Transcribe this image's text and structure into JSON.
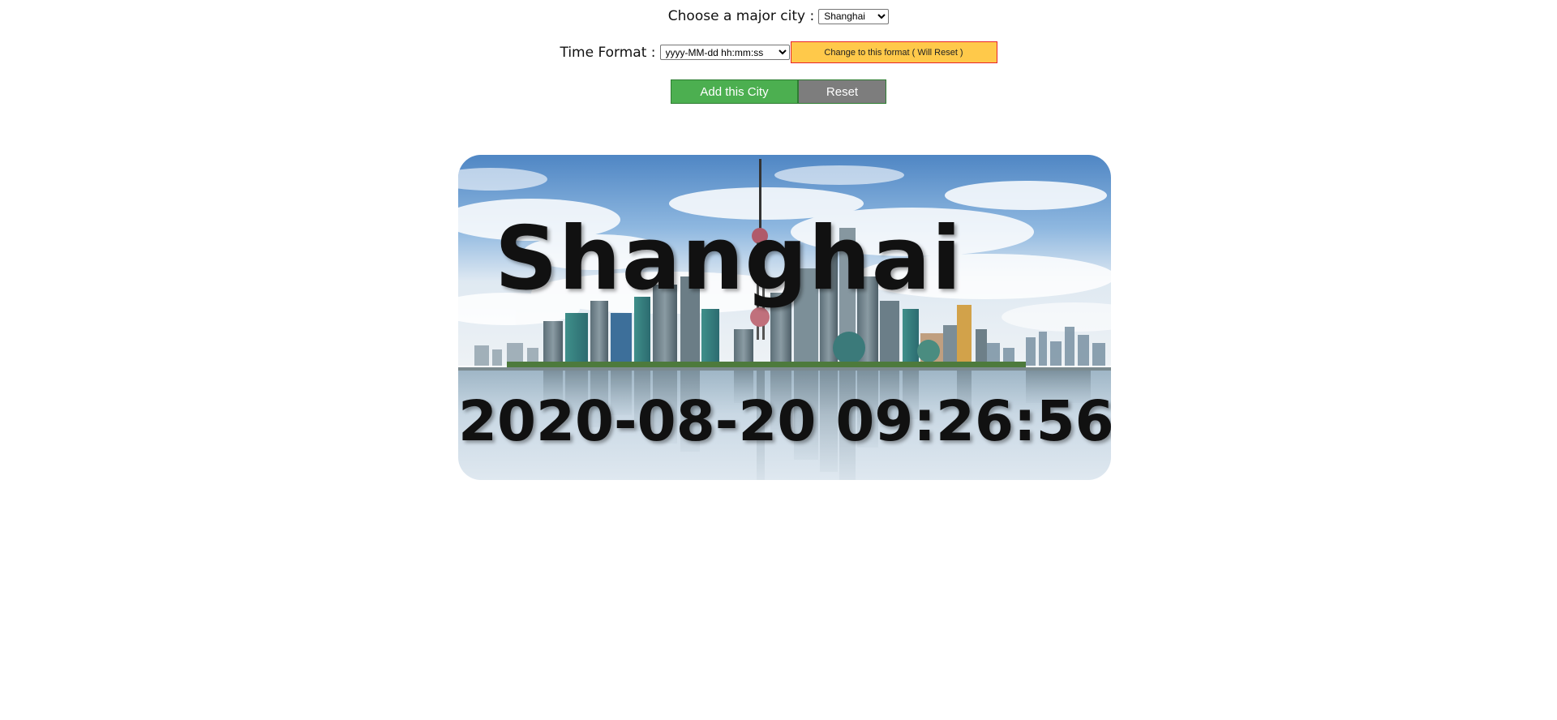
{
  "city_picker": {
    "label": "Choose a major city :",
    "selected": "Shanghai"
  },
  "time_format": {
    "label": "Time Format :",
    "selected": "yyyy-MM-dd hh:mm:ss",
    "change_button": "Change to this format ( Will Reset )"
  },
  "actions": {
    "add_button": "Add this City",
    "reset_button": "Reset"
  },
  "clock_card": {
    "city_name": "Shanghai",
    "time": "2020-08-20 09:26:56",
    "background": "shanghai-skyline-image"
  },
  "colors": {
    "add_button": "#4caf50",
    "reset_button": "#7d7d7d",
    "change_button": "#ffc94a",
    "change_button_border": "#e8232a"
  }
}
